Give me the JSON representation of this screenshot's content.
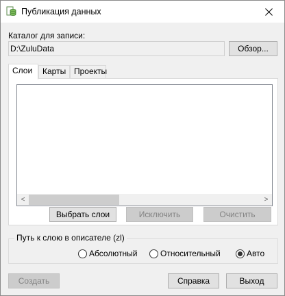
{
  "window": {
    "title": "Публикация данных",
    "icon": "database-publish-icon"
  },
  "catalog": {
    "label": "Каталог для записи:",
    "value": "D:\\ZuluData",
    "browse_label": "Обзор..."
  },
  "tabs": [
    {
      "label": "Слои",
      "active": true
    },
    {
      "label": "Карты",
      "active": false
    },
    {
      "label": "Проекты",
      "active": false
    }
  ],
  "layer_actions": {
    "select_label": "Выбрать слои",
    "exclude_label": "Исключить",
    "clear_label": "Очистить"
  },
  "path_group": {
    "title": "Путь к слою в описателе (zl)",
    "options": [
      {
        "label": "Абсолютный",
        "checked": false
      },
      {
        "label": "Относительный",
        "checked": false
      },
      {
        "label": "Авто",
        "checked": true
      }
    ]
  },
  "footer": {
    "create_label": "Создать",
    "help_label": "Справка",
    "exit_label": "Выход"
  }
}
